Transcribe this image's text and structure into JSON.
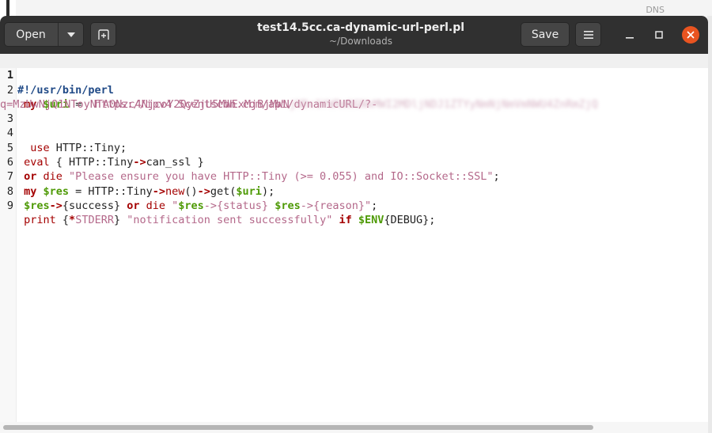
{
  "window": {
    "title": "test14.5cc.ca-dynamic-url-perl.pl",
    "subtitle": "~/Downloads"
  },
  "desktop": {
    "top_right_label": "DNS"
  },
  "toolbar": {
    "open_label": "Open",
    "save_label": "Save"
  },
  "icons": {
    "open_dropdown": "chevron-down-icon",
    "new_tab": "new-tab-icon",
    "menu": "hamburger-menu-icon",
    "minimize": "minimize-icon",
    "maximize": "maximize-icon",
    "close": "close-icon"
  },
  "colors": {
    "headerbar": "#303030",
    "close_button": "#e95420",
    "keyword": "#a40000",
    "variable": "#4e9a06",
    "string": "#b4688a",
    "shebang": "#204a87"
  },
  "editor": {
    "line_numbers": [
      "1",
      "2",
      "3",
      "4",
      "5",
      "6",
      "7",
      "8",
      "9"
    ],
    "lines": {
      "l1": {
        "shebang": "#!/usr/bin/perl"
      },
      "l2": {
        "kw_my": "my",
        "var": "$uri",
        "eq": " = ",
        "str": "'https://ipv4.5centscdn.com/api/dynamicURL/?-",
        "wrap_str": "q=MzUwNjQ1NToyNTA0Nzc4NjcoY2QyZjU5MWExMjBjMWN",
        "wrap_blur": "jNDc1YWRmNGNkMWI2MDljNDJ1ZTYyNmNjNmVmNWU4ZnRmZjQ"
      },
      "l4": {
        "kw": "use",
        "rest": " HTTP::Tiny;"
      },
      "l5": {
        "kw": "eval",
        "rest_a": " { HTTP::Tiny",
        "arrow": "->",
        "rest_b": "can_ssl }"
      },
      "l6": {
        "kw_or": "or",
        "kw_die": " die ",
        "str": "\"Please ensure you have HTTP::Tiny (>= 0.055) and IO::Socket::SSL\"",
        "end": ";"
      },
      "l7": {
        "kw_my": "my",
        "var": " $res",
        "eq": " = HTTP::Tiny",
        "arrow1": "->",
        "new": "new",
        "paren": "()",
        "arrow2": "->",
        "get": "get(",
        "uri": "$uri",
        "end": ");"
      },
      "l8": {
        "var": "$res",
        "arrow": "->",
        "brace": "{success} ",
        "kw_or": "or",
        "kw_die": " die ",
        "str_a": "\"",
        "var2": "$res",
        "arrow2": "->",
        "str_b": "{status} ",
        "var3": "$res",
        "arrow3": "->",
        "str_c": "{reason}\"",
        "end": ";"
      },
      "l9": {
        "kw": "print",
        "brace_a": " {",
        "star": "*",
        "stderr": "STDERR",
        "brace_b": "} ",
        "str": "\"notification sent successfully\"",
        "sp": " ",
        "kw_if": "if",
        "sp2": " ",
        "env": "$ENV",
        "debug": "{DEBUG};"
      }
    }
  }
}
